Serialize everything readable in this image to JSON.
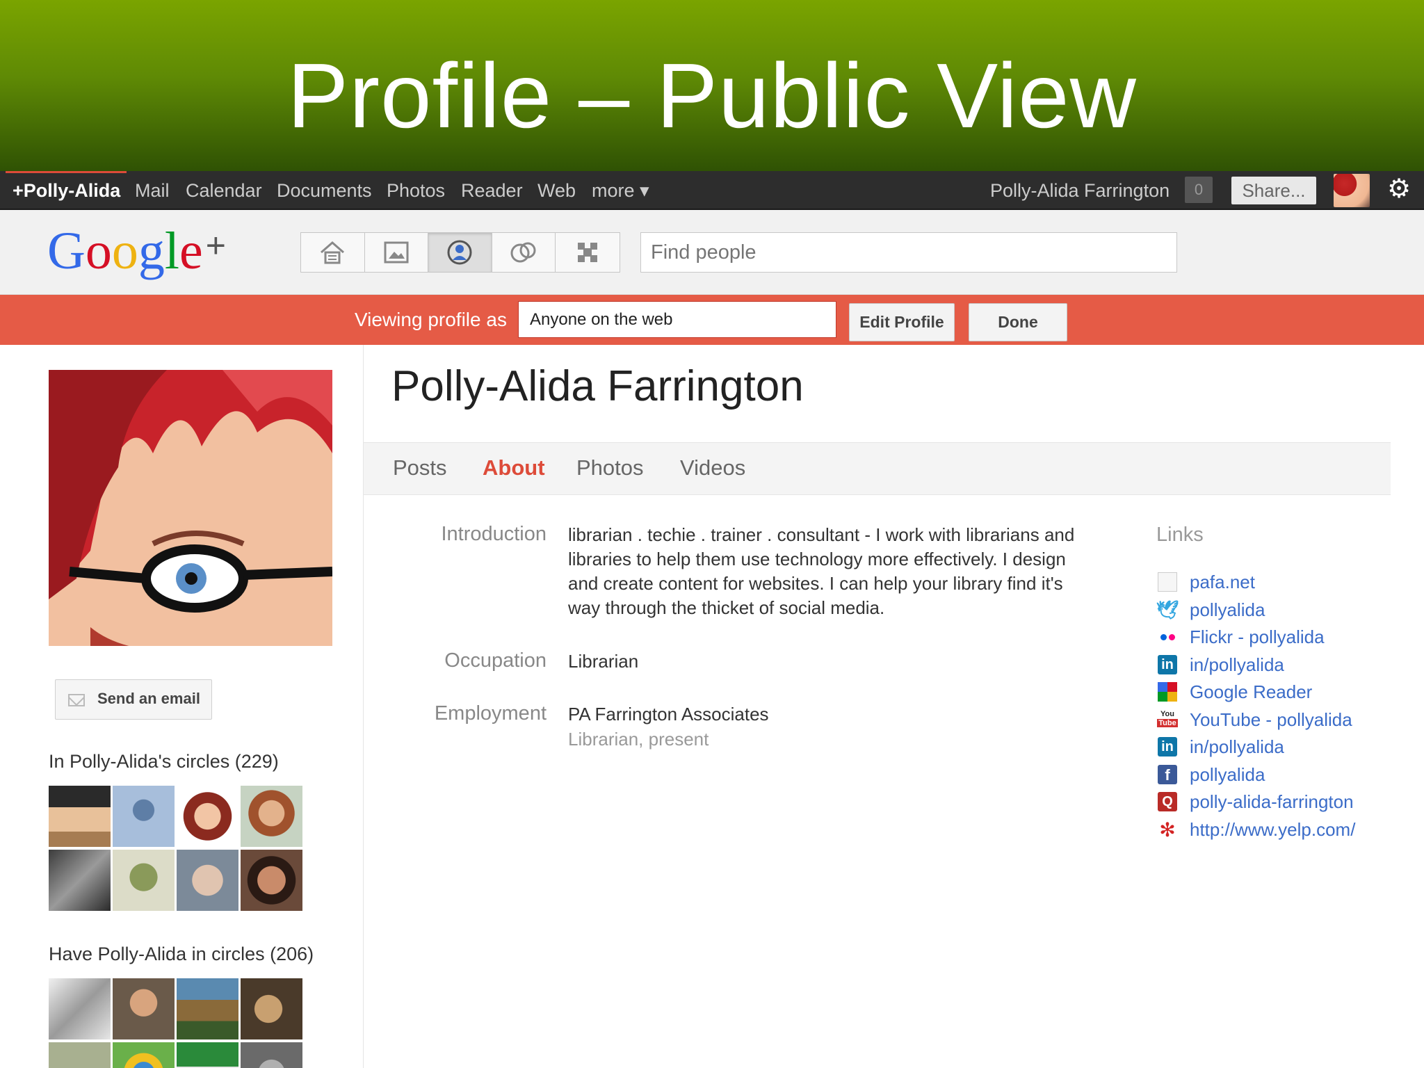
{
  "slide": {
    "title": "Profile – Public View"
  },
  "gbar": {
    "items": [
      "+Polly-Alida",
      "Mail",
      "Calendar",
      "Documents",
      "Photos",
      "Reader",
      "Web",
      "more ▾"
    ],
    "user_name": "Polly-Alida Farrington",
    "notification_count": "0",
    "share_label": "Share..."
  },
  "header": {
    "logo_text": "Google",
    "logo_plus": "+",
    "nav_icons": [
      "home-icon",
      "photos-icon",
      "profile-icon",
      "circles-icon",
      "games-icon"
    ],
    "search_placeholder": "Find people"
  },
  "viewbar": {
    "label": "Viewing profile as",
    "selected": "Anyone on the web",
    "edit_label": "Edit Profile",
    "done_label": "Done"
  },
  "sidebar": {
    "email_label": "Send an email",
    "in_circles_heading": "In Polly-Alida's circles (229)",
    "have_in_circles_heading": "Have Polly-Alida in circles (206)"
  },
  "profile": {
    "name": "Polly-Alida Farrington",
    "tabs": [
      "Posts",
      "About",
      "Photos",
      "Videos"
    ],
    "active_tab": "About",
    "introduction_label": "Introduction",
    "introduction_lines": [
      "librarian . techie . trainer . consultant -  I work with librarians and",
      "libraries to help them use technology more effectively. I design",
      "and create content for websites. I can help your library find it's",
      "way through the thicket of social media."
    ],
    "occupation_label": "Occupation",
    "occupation": "Librarian",
    "employment_label": "Employment",
    "employer": "PA Farrington Associates",
    "employment_detail": "Librarian, present"
  },
  "links": {
    "heading": "Links",
    "items": [
      {
        "text": "pafa.net",
        "icon": "page-icon"
      },
      {
        "text": "pollyalida",
        "icon": "twitter-icon"
      },
      {
        "text": "Flickr - pollyalida",
        "icon": "flickr-icon"
      },
      {
        "text": "in/pollyalida",
        "icon": "linkedin-icon"
      },
      {
        "text": "Google Reader",
        "icon": "google-reader-icon"
      },
      {
        "text": "YouTube - pollyalida",
        "icon": "youtube-icon"
      },
      {
        "text": "in/pollyalida",
        "icon": "linkedin-icon"
      },
      {
        "text": "pollyalida",
        "icon": "facebook-icon"
      },
      {
        "text": "polly-alida-farrington",
        "icon": "quora-icon"
      },
      {
        "text": "http://www.yelp.com/",
        "icon": "yelp-icon"
      }
    ]
  },
  "colors": {
    "accent_red": "#dd4b39",
    "link_blue": "#3b6cc8",
    "banner_green": "#5f8a05",
    "gbar_black": "#2d2d2d"
  }
}
